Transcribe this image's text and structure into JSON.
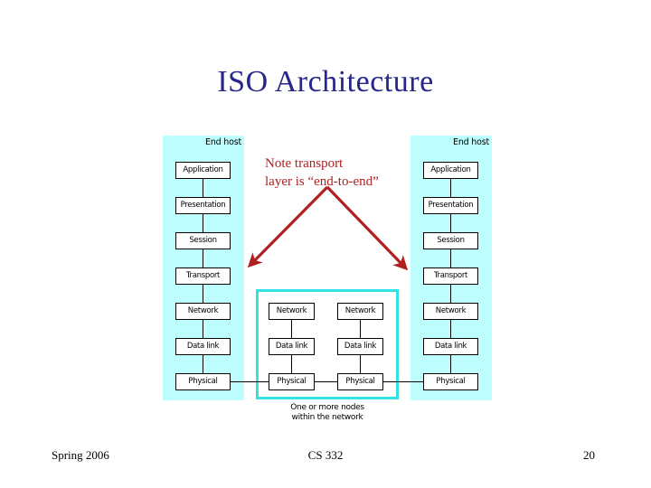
{
  "slide": {
    "title": "ISO Architecture"
  },
  "hosts": {
    "label": "End host",
    "layers": [
      "Application",
      "Presentation",
      "Session",
      "Transport",
      "Network",
      "Data link",
      "Physical"
    ]
  },
  "network": {
    "caption": "One or more nodes\nwithin the network",
    "nodes": [
      {
        "layers": [
          "Network",
          "Data link",
          "Physical"
        ]
      },
      {
        "layers": [
          "Network",
          "Data link",
          "Physical"
        ]
      }
    ],
    "border_color": "#33e3e3"
  },
  "annotation": {
    "text": "Note transport\nlayer is “end-to-end”",
    "color": "#b02020"
  },
  "colors": {
    "title": "#26268c",
    "host_panel": "#bdfdfd",
    "box_fill": "#ffffff",
    "box_border": "#000000"
  },
  "footer": {
    "left": "Spring 2006",
    "center": "CS 332",
    "right": "20"
  }
}
